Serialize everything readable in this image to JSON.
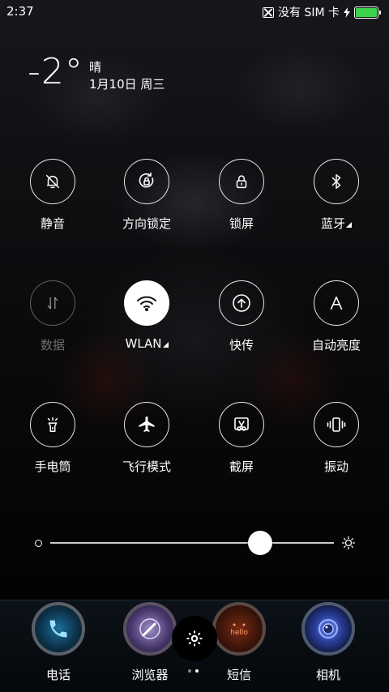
{
  "status_bar": {
    "time": "2:37",
    "sim_text": "没有 SIM 卡",
    "battery_level": 1.0,
    "battery_color": "#3bd44a"
  },
  "weather": {
    "temperature": "-2°",
    "condition": "晴",
    "date": "1月10日 周三"
  },
  "toggles": [
    {
      "label": "静音",
      "icon": "bell-mute-icon",
      "active": false,
      "dimmed": false
    },
    {
      "label": "方向锁定",
      "icon": "rotation-lock-icon",
      "active": false,
      "dimmed": false
    },
    {
      "label": "锁屏",
      "icon": "lock-icon",
      "active": false,
      "dimmed": false
    },
    {
      "label": "蓝牙",
      "icon": "bluetooth-icon",
      "active": false,
      "dimmed": false,
      "expandable": true
    },
    {
      "label": "数据",
      "icon": "mobile-data-icon",
      "active": false,
      "dimmed": true
    },
    {
      "label": "WLAN",
      "icon": "wifi-icon",
      "active": true,
      "dimmed": false,
      "expandable": true
    },
    {
      "label": "快传",
      "icon": "quick-transfer-icon",
      "active": false,
      "dimmed": false
    },
    {
      "label": "自动亮度",
      "icon": "auto-brightness-icon",
      "active": false,
      "dimmed": false
    },
    {
      "label": "手电筒",
      "icon": "flashlight-icon",
      "active": false,
      "dimmed": false
    },
    {
      "label": "飞行模式",
      "icon": "airplane-icon",
      "active": false,
      "dimmed": false
    },
    {
      "label": "截屏",
      "icon": "screenshot-icon",
      "active": false,
      "dimmed": false
    },
    {
      "label": "振动",
      "icon": "vibrate-icon",
      "active": false,
      "dimmed": false
    }
  ],
  "brightness": {
    "level": 0.74
  },
  "dock": {
    "apps": [
      {
        "label": "电话",
        "icon": "phone-icon"
      },
      {
        "label": "浏览器",
        "icon": "browser-icon"
      },
      {
        "label": "短信",
        "icon": "messages-icon"
      },
      {
        "label": "相机",
        "icon": "camera-icon"
      }
    ],
    "settings_icon": "gear-icon",
    "page_count": 2,
    "current_page": 2
  }
}
